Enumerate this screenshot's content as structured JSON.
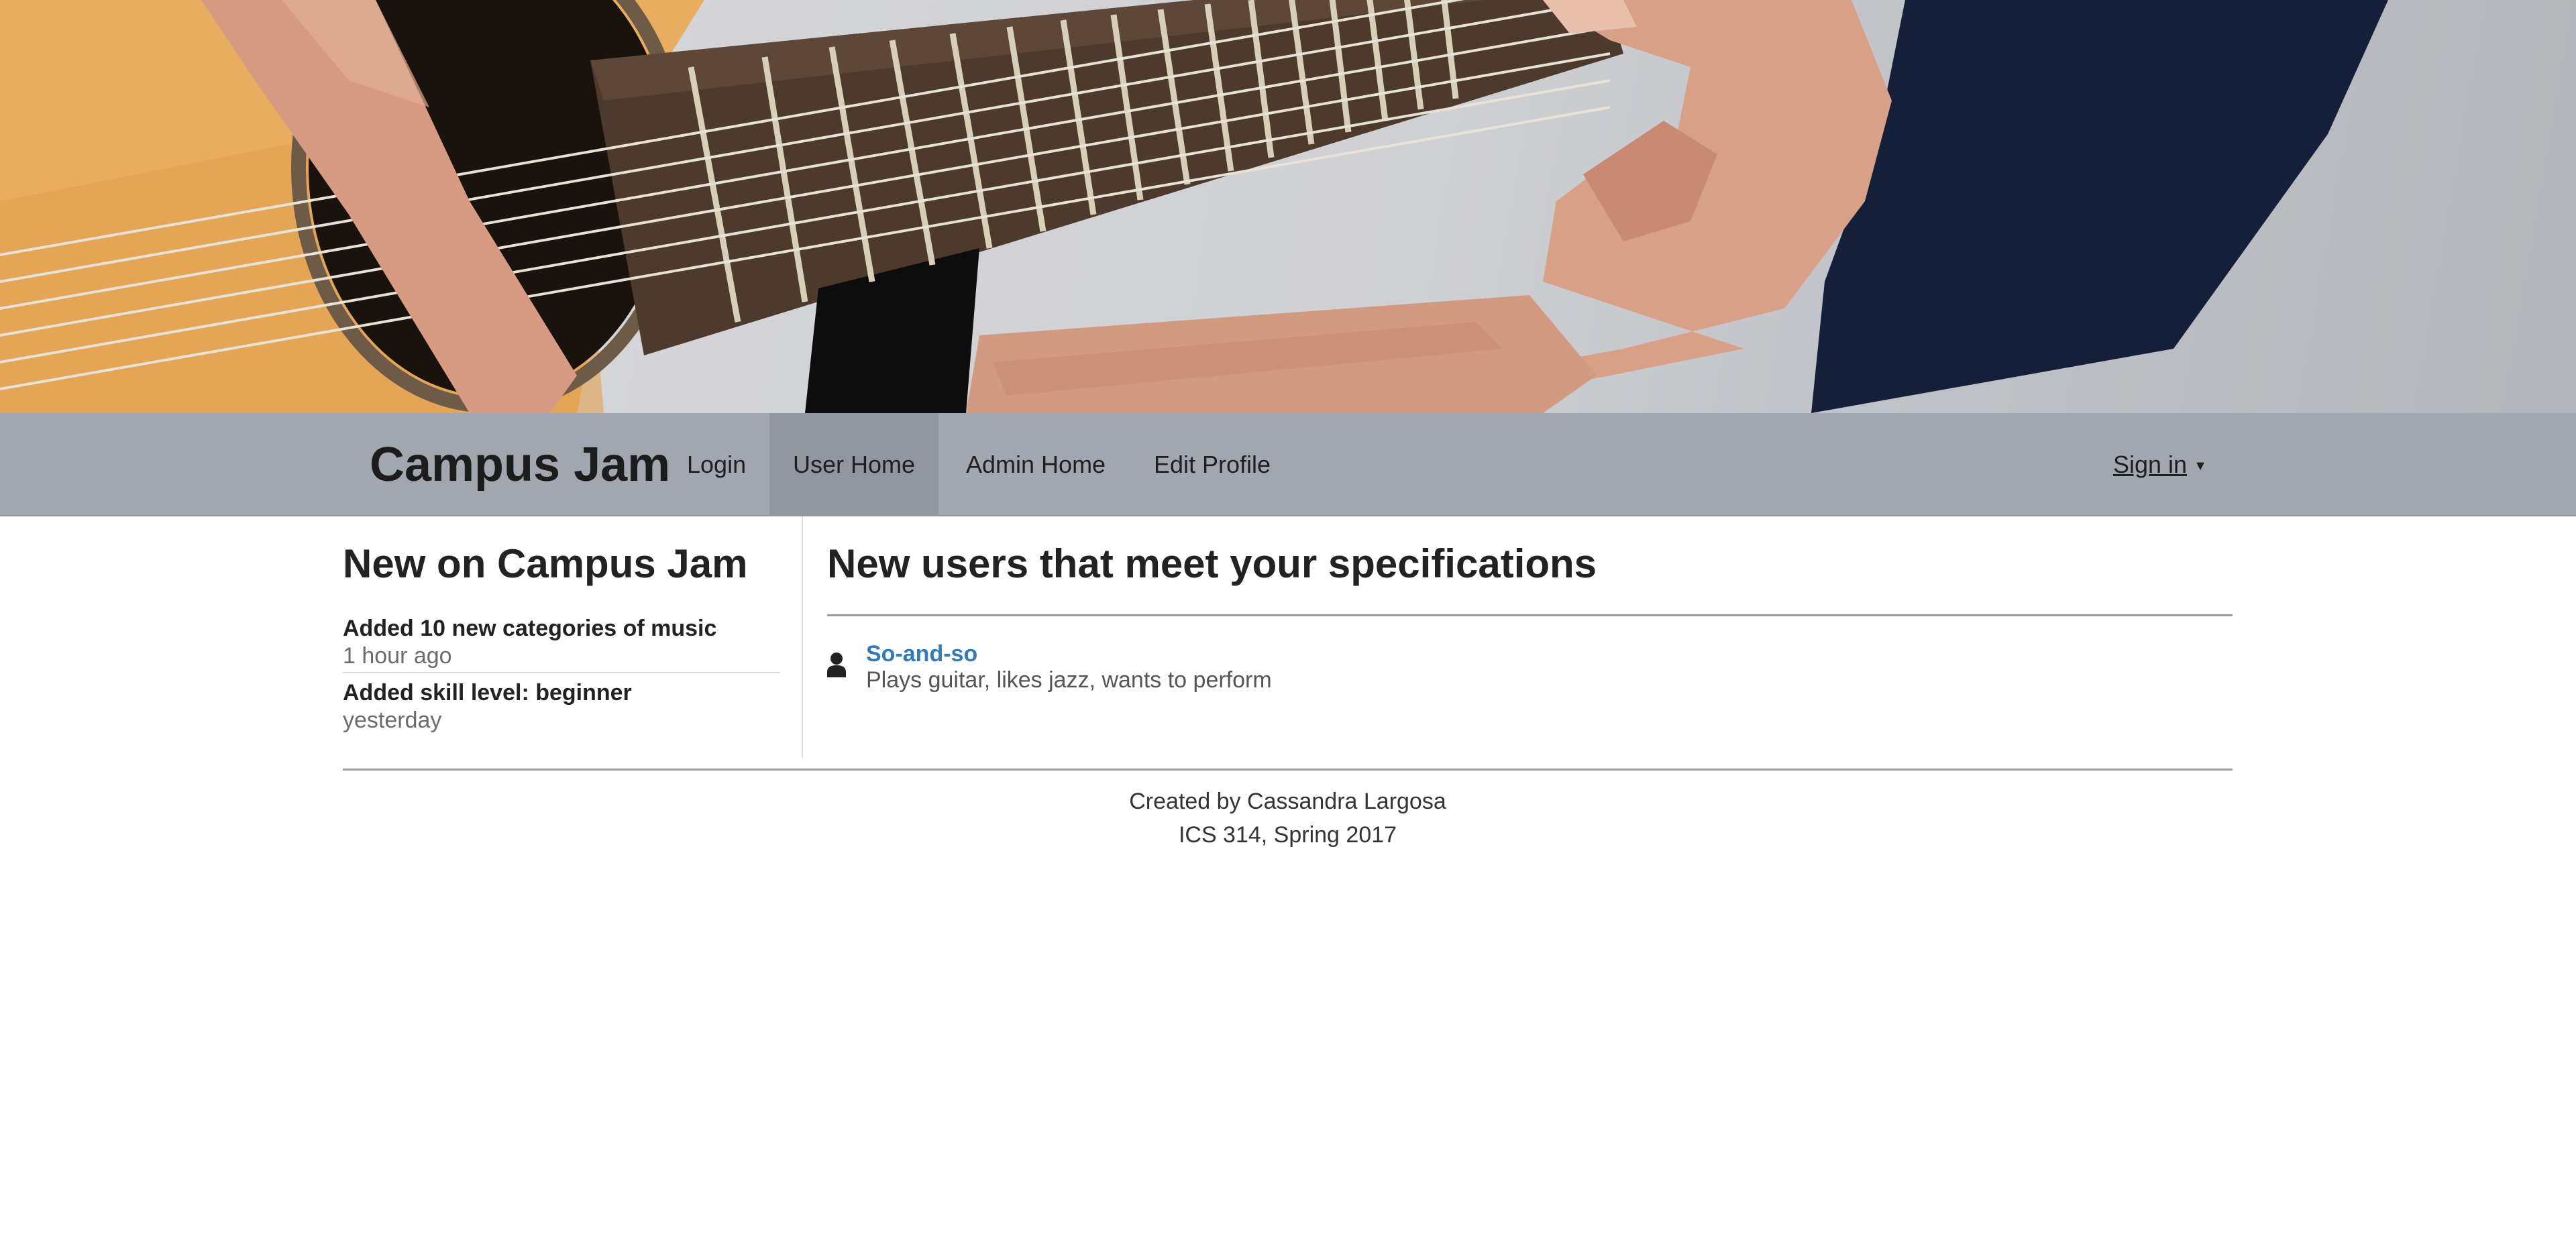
{
  "hero": {
    "image_subject": "guitar-hands-photo"
  },
  "navbar": {
    "brand": "Campus Jam",
    "items": [
      {
        "label": "Login",
        "active": false
      },
      {
        "label": "User Home",
        "active": true
      },
      {
        "label": "Admin Home",
        "active": false
      },
      {
        "label": "Edit Profile",
        "active": false
      }
    ],
    "signin_label": "Sign in",
    "signin_caret": "▼"
  },
  "news": {
    "title": "New on Campus Jam",
    "items": [
      {
        "title": "Added 10 new categories of music",
        "time": "1 hour ago"
      },
      {
        "title": "Added skill level: beginner",
        "time": "yesterday"
      }
    ]
  },
  "matches": {
    "title": "New users that meet your specifications",
    "users": [
      {
        "name": "So-and-so",
        "description": "Plays guitar, likes jazz, wants to perform",
        "icon": "user-icon"
      }
    ]
  },
  "footer": {
    "line1": "Created by Cassandra Largosa",
    "line2": "ICS 314, Spring 2017"
  },
  "colors": {
    "navbar_bg": "#a2a6ae",
    "navbar_active_bg": "#92969e",
    "link": "#337ab7"
  }
}
